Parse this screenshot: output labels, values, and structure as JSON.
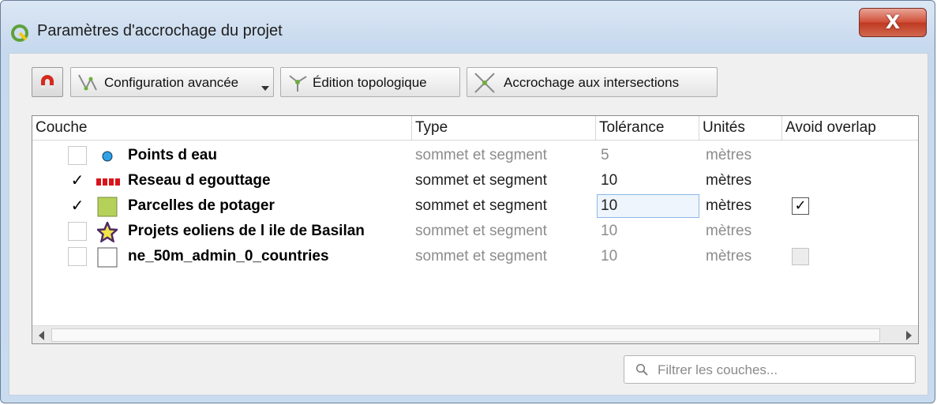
{
  "window": {
    "title": "Paramètres d'accrochage du projet",
    "close_label": "X"
  },
  "toolbar": {
    "magnet_icon": "magnet-icon",
    "advanced_label": "Configuration avancée",
    "topology_label": "Édition topologique",
    "intersection_label": "Accrochage aux intersections"
  },
  "table": {
    "headers": [
      "Couche",
      "Type",
      "Tolérance",
      "Unités",
      "Avoid overlap"
    ],
    "rows": [
      {
        "name": "Points d eau",
        "type": "sommet et segment",
        "tolerance": "5",
        "units": "mètres",
        "checked": false,
        "symbol": "blue-point",
        "avoid": "none"
      },
      {
        "name": "Reseau d egouttage",
        "type": "sommet et segment",
        "tolerance": "10",
        "units": "mètres",
        "checked": true,
        "symbol": "red-dashed-line",
        "avoid": "none"
      },
      {
        "name": "Parcelles de potager",
        "type": "sommet et segment",
        "tolerance": "10",
        "units": "mètres",
        "checked": true,
        "symbol": "green-polygon",
        "avoid": "checked"
      },
      {
        "name": "Projets eoliens de l ile de Basilan",
        "type": "sommet et segment",
        "tolerance": "10",
        "units": "mètres",
        "checked": false,
        "symbol": "purple-star",
        "avoid": "none"
      },
      {
        "name": "ne_50m_admin_0_countries",
        "type": "sommet et segment",
        "tolerance": "10",
        "units": "mètres",
        "checked": false,
        "symbol": "white-polygon",
        "avoid": "disabled"
      }
    ]
  },
  "filter": {
    "placeholder": "Filtrer les couches..."
  },
  "colors": {
    "accent": "#2f7fd0",
    "close": "#c9432c",
    "point": "#2ea3e8",
    "line": "#d9151b",
    "polygon": "#b6d15a",
    "star": "#4f2a63"
  }
}
